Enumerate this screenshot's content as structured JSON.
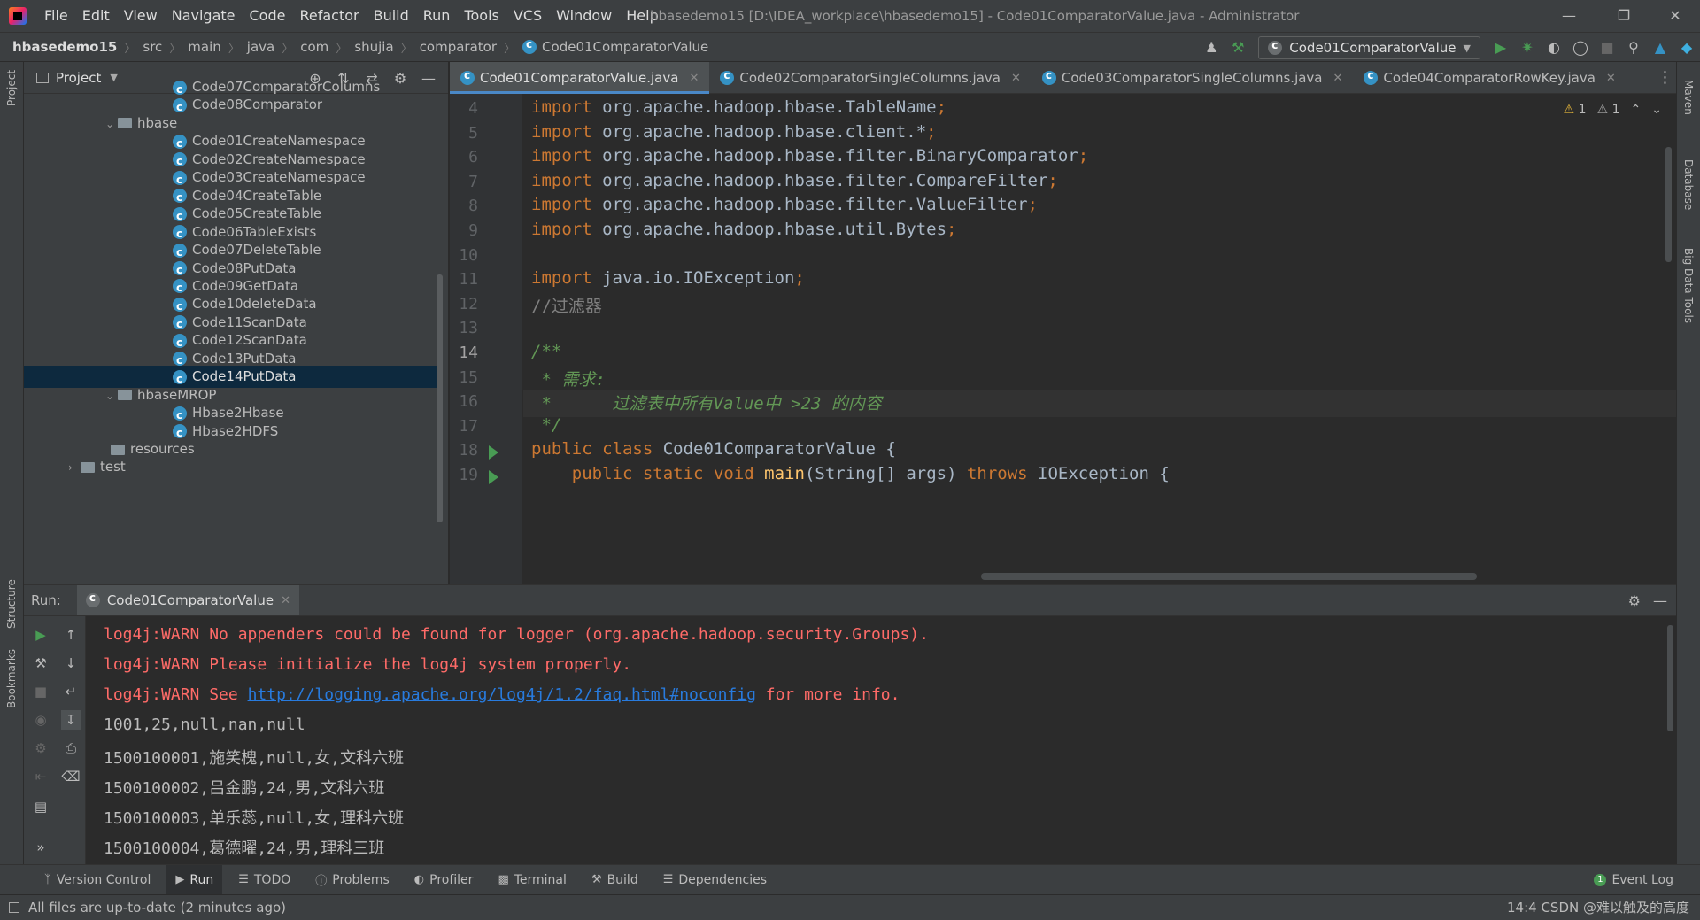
{
  "menu": [
    "File",
    "Edit",
    "View",
    "Navigate",
    "Code",
    "Refactor",
    "Build",
    "Run",
    "Tools",
    "VCS",
    "Window",
    "Help"
  ],
  "window_title": "hbasedemo15 [D:\\IDEA_workplace\\hbasedemo15] - Code01ComparatorValue.java - Administrator",
  "breadcrumbs": [
    "hbasedemo15",
    "src",
    "main",
    "java",
    "com",
    "shujia",
    "comparator",
    "Code01ComparatorValue"
  ],
  "run_config": "Code01ComparatorValue",
  "project": {
    "title": "Project",
    "tree": [
      {
        "label": "Code07ComparatorColumns",
        "kind": "class",
        "depth": 2
      },
      {
        "label": "Code08Comparator",
        "kind": "class",
        "depth": 2
      },
      {
        "label": "hbase",
        "kind": "folder",
        "depth": 1,
        "expanded": true
      },
      {
        "label": "Code01CreateNamespace",
        "kind": "class",
        "depth": 2
      },
      {
        "label": "Code02CreateNamespace",
        "kind": "class",
        "depth": 2
      },
      {
        "label": "Code03CreateNamespace",
        "kind": "class",
        "depth": 2
      },
      {
        "label": "Code04CreateTable",
        "kind": "class",
        "depth": 2
      },
      {
        "label": "Code05CreateTable",
        "kind": "class",
        "depth": 2
      },
      {
        "label": "Code06TableExists",
        "kind": "class",
        "depth": 2
      },
      {
        "label": "Code07DeleteTable",
        "kind": "class",
        "depth": 2
      },
      {
        "label": "Code08PutData",
        "kind": "class",
        "depth": 2
      },
      {
        "label": "Code09GetData",
        "kind": "class",
        "depth": 2
      },
      {
        "label": "Code10deleteData",
        "kind": "class",
        "depth": 2
      },
      {
        "label": "Code11ScanData",
        "kind": "class",
        "depth": 2
      },
      {
        "label": "Code12ScanData",
        "kind": "class",
        "depth": 2
      },
      {
        "label": "Code13PutData",
        "kind": "class",
        "depth": 2
      },
      {
        "label": "Code14PutData",
        "kind": "class",
        "depth": 2,
        "selected": true
      },
      {
        "label": "hbaseMROP",
        "kind": "folder",
        "depth": 1,
        "expanded": true
      },
      {
        "label": "Hbase2Hbase",
        "kind": "class",
        "depth": 2
      },
      {
        "label": "Hbase2HDFS",
        "kind": "class",
        "depth": 2
      },
      {
        "label": "resources",
        "kind": "folder",
        "depth": 0
      },
      {
        "label": "test",
        "kind": "folder",
        "depth": -1,
        "expanded": false
      }
    ]
  },
  "editor_tabs": [
    {
      "label": "Code01ComparatorValue.java",
      "active": true
    },
    {
      "label": "Code02ComparatorSingleColumns.java",
      "active": false
    },
    {
      "label": "Code03ComparatorSingleColumns.java",
      "active": false
    },
    {
      "label": "Code04ComparatorRowKey.java",
      "active": false
    }
  ],
  "editor": {
    "warnings": "1",
    "weak_warnings": "1",
    "current_line": "14",
    "lines": [
      {
        "n": "4",
        "code": "import org.apache.hadoop.hbase.TableName;"
      },
      {
        "n": "5",
        "code": "import org.apache.hadoop.hbase.client.*;"
      },
      {
        "n": "6",
        "code": "import org.apache.hadoop.hbase.filter.BinaryComparator;"
      },
      {
        "n": "7",
        "code": "import org.apache.hadoop.hbase.filter.CompareFilter;"
      },
      {
        "n": "8",
        "code": "import org.apache.hadoop.hbase.filter.ValueFilter;"
      },
      {
        "n": "9",
        "code": "import org.apache.hadoop.hbase.util.Bytes;"
      },
      {
        "n": "10",
        "code": ""
      },
      {
        "n": "11",
        "code": "import java.io.IOException;"
      },
      {
        "n": "12",
        "code": "//过滤器"
      },
      {
        "n": "13",
        "code": ""
      },
      {
        "n": "14",
        "code": "/**"
      },
      {
        "n": "15",
        "code": " * 需求:"
      },
      {
        "n": "16",
        "code": " *      过滤表中所有Value中 >23 的内容"
      },
      {
        "n": "17",
        "code": " */"
      },
      {
        "n": "18",
        "code": "public class Code01ComparatorValue {"
      },
      {
        "n": "19",
        "code": "    public static void main(String[] args) throws IOException {"
      }
    ]
  },
  "run_panel": {
    "label": "Run:",
    "tab": "Code01ComparatorValue",
    "console": [
      {
        "text": "log4j:WARN No appenders could be found for logger (org.apache.hadoop.security.Groups).",
        "type": "err"
      },
      {
        "text": "log4j:WARN Please initialize the log4j system properly.",
        "type": "err"
      },
      {
        "text_before": "log4j:WARN See ",
        "link": "http://logging.apache.org/log4j/1.2/faq.html#noconfig",
        "text_after": " for more info.",
        "type": "err-link"
      },
      {
        "text": "1001,25,null,nan,null",
        "type": "out"
      },
      {
        "text": "1500100001,施笑槐,null,女,文科六班",
        "type": "out"
      },
      {
        "text": "1500100002,吕金鹏,24,男,文科六班",
        "type": "out"
      },
      {
        "text": "1500100003,单乐蕊,null,女,理科六班",
        "type": "out"
      },
      {
        "text": "1500100004,葛德曜,24,男,理科三班",
        "type": "out"
      }
    ]
  },
  "bottom_tools": [
    "Version Control",
    "Run",
    "TODO",
    "Problems",
    "Profiler",
    "Terminal",
    "Build",
    "Dependencies"
  ],
  "event_log": "Event Log",
  "status": {
    "message": "All files are up-to-date (2 minutes ago)",
    "right": "14:4 CSDN @难以触及的高度"
  },
  "side_labels": {
    "left": [
      "Project",
      "Structure",
      "Bookmarks"
    ],
    "right": [
      "Maven",
      "Database",
      "Big Data Tools"
    ]
  },
  "colors": {
    "keyword": "#cc7832",
    "comment": "#808080",
    "doc": "#629755",
    "error": "#ff6b68",
    "link": "#287bde",
    "selection": "#0d293e"
  }
}
